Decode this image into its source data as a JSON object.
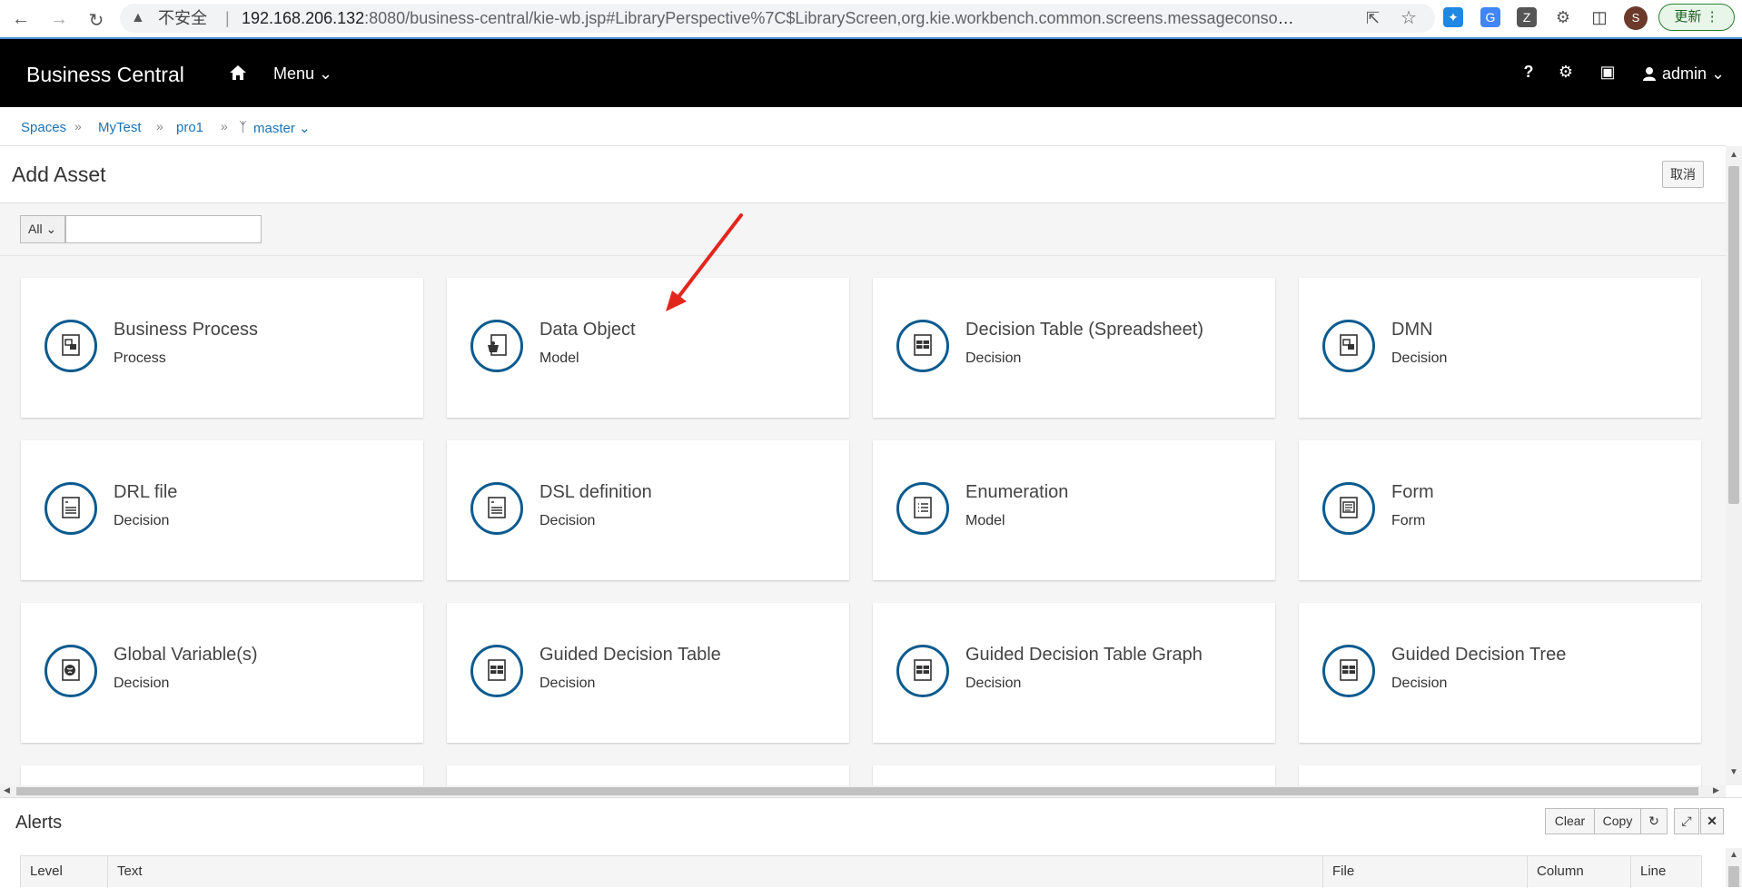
{
  "browser": {
    "security_label": "不安全",
    "url_host": "192.168.206.132",
    "url_rest": ":8080/business-central/kie-wb.jsp#LibraryPerspective%7C$LibraryScreen,org.kie.workbench.common.screens.messageconsole.Me...",
    "profile_initial": "S",
    "update_label": "更新"
  },
  "header": {
    "brand": "Business Central",
    "menu_label": "Menu",
    "user_label": "admin"
  },
  "breadcrumb": {
    "items": [
      "Spaces",
      "MyTest",
      "pro1",
      "master"
    ]
  },
  "page": {
    "title": "Add Asset",
    "cancel_label": "取消"
  },
  "filter": {
    "selected": "All",
    "search_value": ""
  },
  "assets": [
    {
      "name": "Business Process",
      "category": "Process",
      "icon": "process-icon"
    },
    {
      "name": "Data Object",
      "category": "Model",
      "icon": "data-object-icon"
    },
    {
      "name": "Decision Table (Spreadsheet)",
      "category": "Decision",
      "icon": "decision-table-icon"
    },
    {
      "name": "DMN",
      "category": "Decision",
      "icon": "dmn-icon"
    },
    {
      "name": "DRL file",
      "category": "Decision",
      "icon": "drl-icon"
    },
    {
      "name": "DSL definition",
      "category": "Decision",
      "icon": "dsl-icon"
    },
    {
      "name": "Enumeration",
      "category": "Model",
      "icon": "enumeration-icon"
    },
    {
      "name": "Form",
      "category": "Form",
      "icon": "form-icon"
    },
    {
      "name": "Global Variable(s)",
      "category": "Decision",
      "icon": "global-variable-icon"
    },
    {
      "name": "Guided Decision Table",
      "category": "Decision",
      "icon": "guided-table-icon"
    },
    {
      "name": "Guided Decision Table Graph",
      "category": "Decision",
      "icon": "guided-table-graph-icon"
    },
    {
      "name": "Guided Decision Tree",
      "category": "Decision",
      "icon": "guided-tree-icon"
    }
  ],
  "alerts": {
    "title": "Alerts",
    "clear_label": "Clear",
    "copy_label": "Copy",
    "columns": [
      "Level",
      "Text",
      "File",
      "Column",
      "Line"
    ]
  },
  "colors": {
    "header_bg": "#000000",
    "link": "#1a73b8",
    "icon_ring": "#0b5b8f",
    "annotation_arrow": "#e3261d"
  }
}
